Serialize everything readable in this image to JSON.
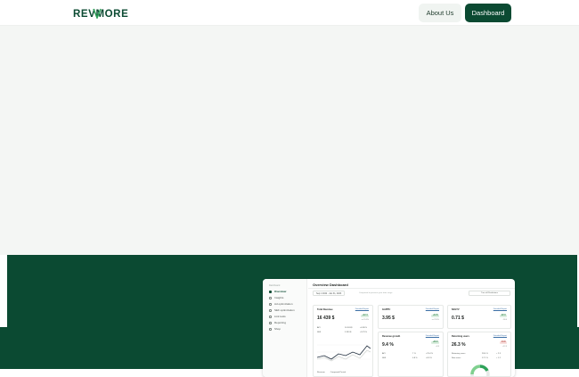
{
  "header": {
    "logo_text": "REVMORE",
    "about_label": "About Us",
    "dashboard_label": "Dashboard"
  },
  "colors": {
    "brand_green": "#0b4a32",
    "hero_bg": "#f4f6f4"
  },
  "preview": {
    "sidebar_brand": "Dashboard",
    "nav": [
      "Overview",
      "Insights",
      "Ad optimization",
      "SEF optimization",
      "Link tests",
      "Reporting",
      "Shop"
    ],
    "title": "Overview Dashboard",
    "date_range": "Sep 1 2022 - Jan 31, 2023",
    "compare_text": "Compared to previous year date range",
    "turnoff_label": "Turn off Predictions",
    "cards": [
      {
        "title": "Total Revenue",
        "link": "Detailed Report",
        "value": "16 439 $",
        "delta": "+12.4",
        "sub": "vs 15.3%",
        "rows": [
          [
            "API",
            "16 303 $",
            "+6.98 %"
          ],
          [
            "SEF",
            "3 353 $",
            "+9.79 %"
          ]
        ]
      },
      {
        "title": "GAPPU",
        "link": "Detailed Report",
        "value": "3.95 $",
        "delta": "+12.8",
        "sub": "vs 22.4%"
      },
      {
        "title": "NOLTV",
        "link": "Detailed Report",
        "value": "0.71 $",
        "delta": "-22.3",
        "sub": "-58.0"
      },
      {
        "title": "Revenue growth",
        "link": "Detailed Report",
        "value": "9.4 %",
        "delta": "+40.0",
        "sub": "+8.9",
        "rows": [
          [
            "API",
            "7 %",
            "+23.4 %"
          ],
          [
            "SEF",
            "0.8 %",
            "+8.9 %"
          ]
        ]
      },
      {
        "title": "Returning users",
        "link": "Detailed Report",
        "value": "26.3 %",
        "delta": "-13.8",
        "sub": "+12.5",
        "rows": [
          [
            "Returning users",
            "28.6 %",
            "+ 2.3"
          ],
          [
            "New users",
            "17.2 %",
            "+ 1.2"
          ]
        ]
      }
    ],
    "legend": [
      "Revenue",
      "Compared Period"
    ]
  }
}
